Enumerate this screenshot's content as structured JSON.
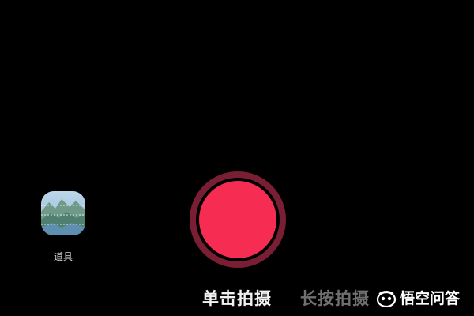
{
  "props": {
    "label": "道具",
    "icon": "props-thumbnail-icon"
  },
  "shutter": {
    "icon": "record-shutter-icon",
    "color": "#f62c52",
    "ring_color": "#7a1f33"
  },
  "modes": {
    "tap": "单击拍摄",
    "hold": "长按拍摄",
    "active": "单击拍摄"
  },
  "watermark": {
    "text": "悟空问答",
    "icon": "wukong-logo-icon"
  }
}
